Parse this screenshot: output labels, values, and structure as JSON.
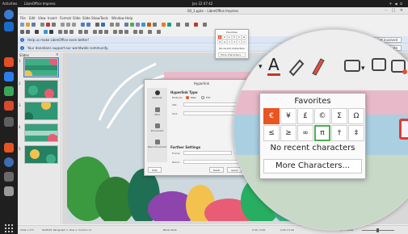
{
  "topbar": {
    "activities": "Activities",
    "app": "LibreOffice Impress",
    "clock": "Jan 22  07:42",
    "tray": "⚘ ◀ ⏻"
  },
  "window": {
    "title": "00_1.pptx – LibreOffice Impress",
    "controls": "– ▢ ✕"
  },
  "menu": [
    "File",
    "Edit",
    "View",
    "Insert",
    "Format",
    "Slide",
    "Slide Show",
    "Tools",
    "Window",
    "Help"
  ],
  "infobars": [
    {
      "message": "Help us make LibreOffice even better!",
      "button": "Get involved"
    },
    {
      "message": "Your donations support our worldwide community.",
      "button": "Donate"
    }
  ],
  "slides_pane": {
    "title": "Slides"
  },
  "dialog": {
    "title": "Hyperlink",
    "sidebar": [
      "Internet",
      "Mail",
      "Document",
      "New Document"
    ],
    "type_group": "Hyperlink Type",
    "type_options": [
      "Protocol:",
      "Web",
      "FTP"
    ],
    "url_label": "URL:",
    "text_label": "Text:",
    "further_group": "Further Settings",
    "frame_label": "Frame:",
    "form_label": "Form:",
    "name_label": "Name:",
    "buttons": [
      "Help",
      "Reset",
      "Apply",
      "Close"
    ]
  },
  "special_characters_popup": {
    "title": "Favorites",
    "favorites": [
      "€",
      "¥",
      "£",
      "©",
      "Σ",
      "Ω",
      "≤",
      "≥",
      "∞",
      "π",
      "†",
      "‡"
    ],
    "no_recent": "No recent characters",
    "more_button": "More Characters..."
  },
  "statusbar": {
    "slide": "Slide 1 of 5",
    "selection": "TextEdit: Paragraph 1, Row 1, Column 11",
    "master": "Blank Slide",
    "position": "0.00 / 0.00",
    "size": "0.00 x 0.00",
    "language": "English (USA)"
  },
  "colors": {
    "accent": "#e95420",
    "hover_highlight": "#4caf50",
    "infobar": "#dce6f4"
  }
}
